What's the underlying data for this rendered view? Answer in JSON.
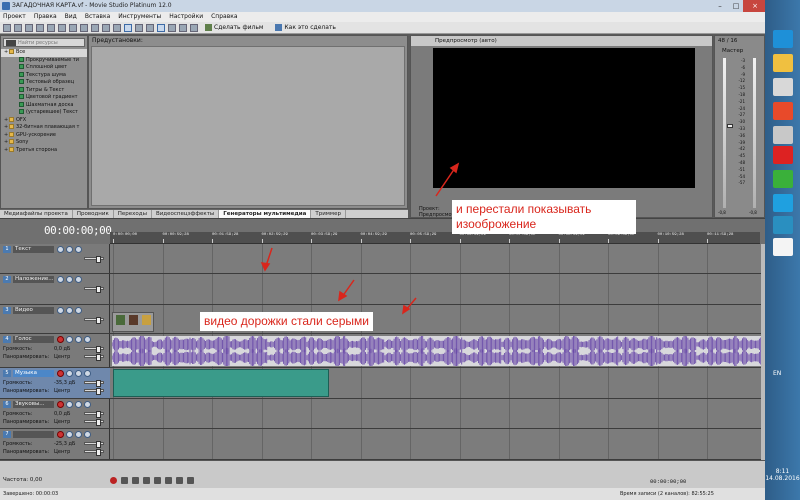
{
  "window": {
    "title": "ЗАГАДОЧНАЯ КАРТА.vf - Movie Studio Platinum 12.0"
  },
  "menu": [
    "Проект",
    "Правка",
    "Вид",
    "Вставка",
    "Инструменты",
    "Настройки",
    "Справка"
  ],
  "toolbar": {
    "make_movie": "Сделать фильм",
    "how_to": "Как это сделать"
  },
  "explorer": {
    "search_placeholder": "Найти ресурсы",
    "tree": [
      {
        "label": "Все",
        "level": 0,
        "kind": "folder",
        "selected": true
      },
      {
        "label": "Прокручиваемые ти",
        "level": 1,
        "kind": "gen"
      },
      {
        "label": "Сплошной цвет",
        "level": 1,
        "kind": "gen"
      },
      {
        "label": "Текстура шума",
        "level": 1,
        "kind": "gen"
      },
      {
        "label": "Тестовый образец",
        "level": 1,
        "kind": "gen"
      },
      {
        "label": "Титры & Текст",
        "level": 1,
        "kind": "gen"
      },
      {
        "label": "Цветовой градиент",
        "level": 1,
        "kind": "gen"
      },
      {
        "label": "Шахматная доска",
        "level": 1,
        "kind": "gen"
      },
      {
        "label": "(устаревшее) Текст",
        "level": 1,
        "kind": "gen"
      },
      {
        "label": "OFX",
        "level": 0,
        "kind": "folder"
      },
      {
        "label": "32-битная плавающая т",
        "level": 0,
        "kind": "folder"
      },
      {
        "label": "GPU-ускорение",
        "level": 0,
        "kind": "folder"
      },
      {
        "label": "Sony",
        "level": 0,
        "kind": "folder"
      },
      {
        "label": "Третья сторона",
        "level": 0,
        "kind": "folder"
      }
    ]
  },
  "presets": {
    "header": "Предустановки:"
  },
  "tabs": [
    {
      "label": "Медиафайлы проекта",
      "active": false
    },
    {
      "label": "Проводник",
      "active": false
    },
    {
      "label": "Переходы",
      "active": false
    },
    {
      "label": "Видеоспецэффекты",
      "active": false
    },
    {
      "label": "Генераторы мультимедиа",
      "active": true
    },
    {
      "label": "Триммер",
      "active": false
    }
  ],
  "preview": {
    "mode": "Предпросмотр (авто)",
    "info_project": "Проект:",
    "info_preview": "Предпросмотр:"
  },
  "master": {
    "label": "Мастер",
    "value": "48 / 16",
    "scale": [
      "-3",
      "-6",
      "-9",
      "-12",
      "-15",
      "-18",
      "-21",
      "-24",
      "-27",
      "-30",
      "-33",
      "-36",
      "-39",
      "-42",
      "-45",
      "-48",
      "-51",
      "-54",
      "-57"
    ],
    "bottom_left": "-0,8",
    "bottom_right": "-0,8"
  },
  "timeline": {
    "timecode": "00:00:00;00",
    "ruler": [
      "0:00:00;00",
      "00:00:59;28",
      "00:01:59;28",
      "00:02:59;29",
      "00:03:59;29",
      "00:04:59;29",
      "00:05:59;29",
      "00:06:59;29",
      "00:07:59;02",
      "00:08:59;02",
      "00:09:59;02",
      "00:10:59;28",
      "00:11:59;28"
    ]
  },
  "tracks": [
    {
      "num": "1",
      "name": "Текст",
      "type": "video"
    },
    {
      "num": "2",
      "name": "Наложение...",
      "type": "video"
    },
    {
      "num": "3",
      "name": "Видео",
      "type": "video"
    },
    {
      "num": "4",
      "name": "Голос",
      "type": "audio",
      "volume_label": "Громкость:",
      "volume": "0,0 дБ",
      "pan_label": "Панорамировать:",
      "pan": "Центр"
    },
    {
      "num": "5",
      "name": "Музыка",
      "type": "audio",
      "selected": true,
      "volume_label": "Громкость:",
      "volume": "-35,3 дБ",
      "pan_label": "Панорамировать:",
      "pan": "Центр"
    },
    {
      "num": "6",
      "name": "Звуковы...",
      "type": "audio",
      "volume_label": "Громкость:",
      "volume": "0,0 дБ",
      "pan_label": "Панорамировать:",
      "pan": "Центр"
    },
    {
      "num": "7",
      "name": "",
      "type": "audio",
      "volume_label": "Громкость:",
      "volume": "-25,3 дБ",
      "pan_label": "Панорамировать:",
      "pan": "Центр"
    }
  ],
  "transport": {
    "rate": "Частота: 0,00",
    "timecode_right": "00:00:00;00"
  },
  "status": {
    "completed": "Завершено: 00:00:03",
    "record_time": "Время записи (2 каналов): 82:55:25"
  },
  "taskbar": {
    "lang": "EN",
    "time": "8:11",
    "date": "14.08.2016"
  },
  "annotations": {
    "preview_note": "и перестали показывать изооброжение",
    "tracks_note": "видео дорожки стали серыми"
  },
  "colors": {
    "annotation_text": "#d9261c",
    "audio_wave": "#6a4aa8",
    "music_clip": "#3a9b8a",
    "selected_track": "#4c87c8"
  }
}
